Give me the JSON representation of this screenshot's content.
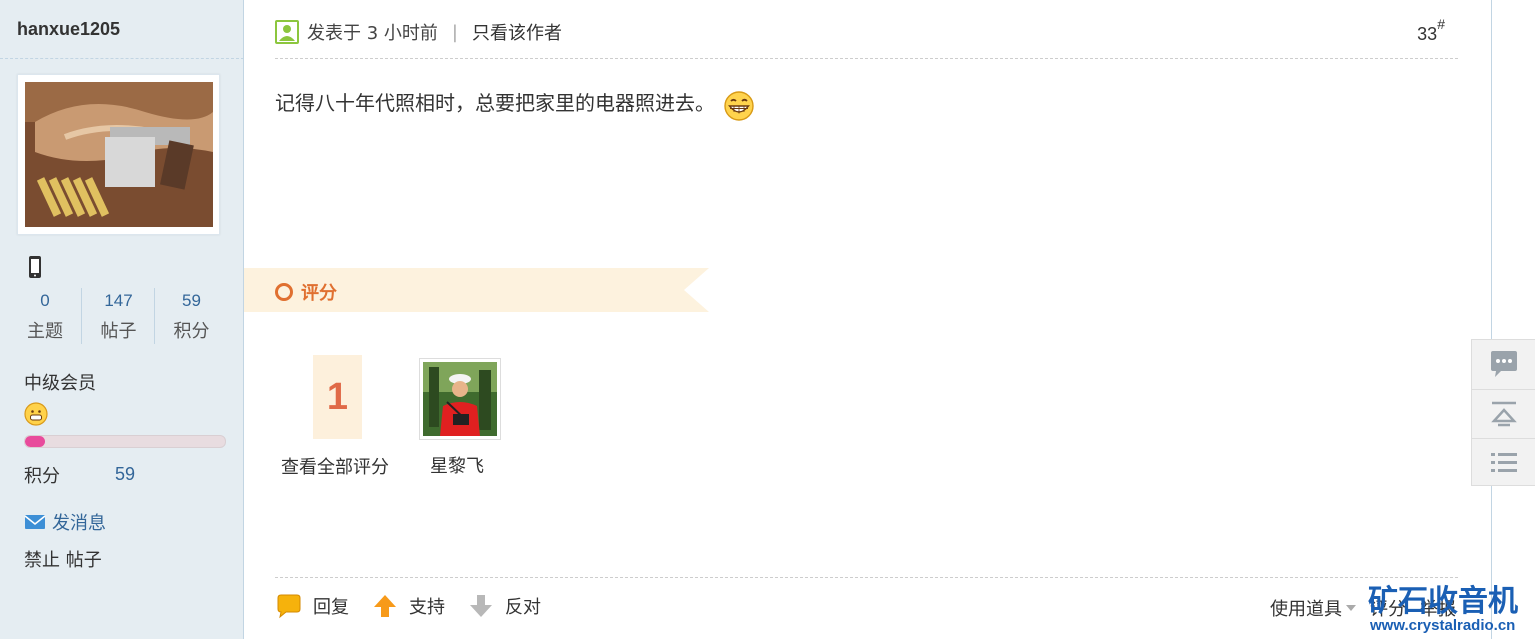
{
  "author": {
    "username": "hanxue1205",
    "stats": [
      {
        "value": "0",
        "label": "主题"
      },
      {
        "value": "147",
        "label": "帖子"
      },
      {
        "value": "59",
        "label": "积分"
      }
    ],
    "level": "中级会员",
    "level_progress": 0.1,
    "points_label": "积分",
    "points_value": "59",
    "send_message": "发消息",
    "ban_label": "禁止 帖子"
  },
  "post": {
    "posted": "发表于 3 小时前",
    "only_author": "只看该作者",
    "floor": "33",
    "floor_sup": "#",
    "body": "记得八十年代照相时，总要把家里的电器照进去。",
    "rate": {
      "title": "评分",
      "count": "1",
      "view_all": "查看全部评分",
      "raters": [
        {
          "name": "星黎飞"
        }
      ]
    },
    "actions": {
      "reply": "回复",
      "support": "支持",
      "oppose": "反对"
    },
    "tools": {
      "use_props": "使用道具",
      "rate": "评分",
      "report": "举报"
    }
  },
  "watermark": {
    "title": "矿石收音机",
    "url": "www.crystalradio.cn"
  },
  "colors": {
    "sidebar_bg": "#e5edf2",
    "link_blue": "#336699",
    "rate_orange": "#e07030",
    "score_red": "#e06a48",
    "progress_pink": "#e84b9c",
    "watermark_blue": "#1a5fb4"
  }
}
